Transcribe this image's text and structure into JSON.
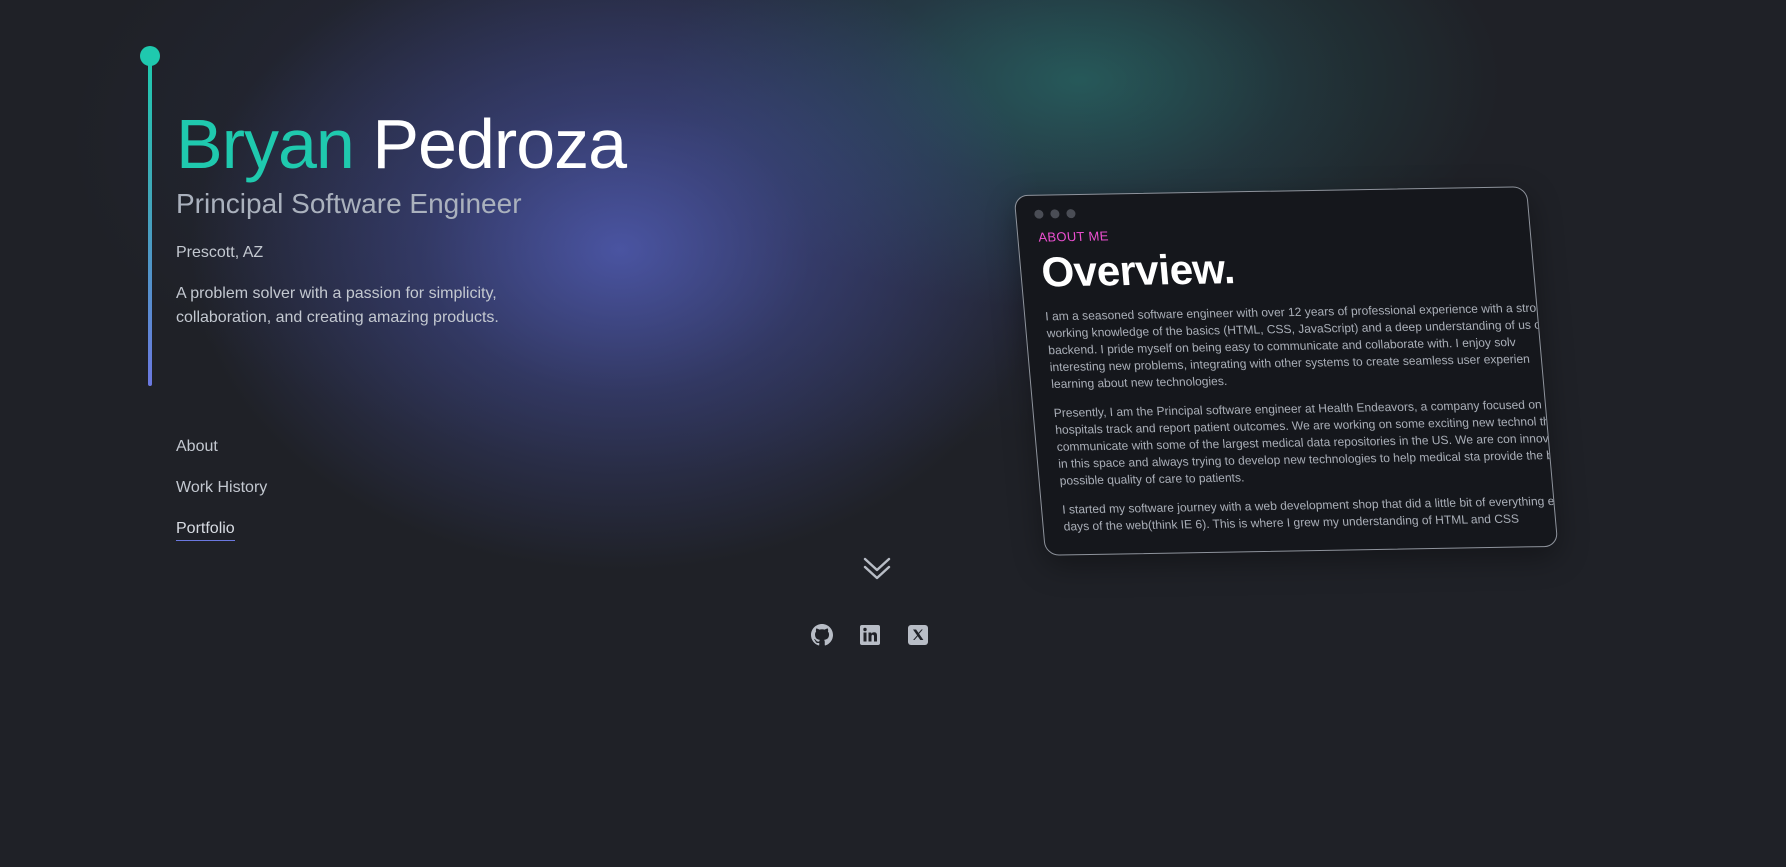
{
  "hero": {
    "first_name": "Bryan",
    "last_name": "Pedroza",
    "role": "Principal Software Engineer",
    "location": "Prescott, AZ",
    "tagline": "A problem solver with a passion for simplicity, collaboration, and creating amazing products."
  },
  "nav": {
    "items": [
      {
        "label": "About"
      },
      {
        "label": "Work History"
      },
      {
        "label": "Portfolio"
      }
    ],
    "active": "Portfolio"
  },
  "socials": [
    {
      "icon": "github-icon"
    },
    {
      "icon": "linkedin-icon"
    },
    {
      "icon": "x-icon"
    }
  ],
  "card": {
    "kicker": "ABOUT ME",
    "title": "Overview.",
    "paragraphs": [
      "I am a seasoned software engineer with over 12 years of professional experience with a stro working knowledge of the basics (HTML, CSS, JavaScript) and a deep understanding of us on backend. I pride myself on being easy to communicate and collaborate with. I enjoy solv interesting new problems, integrating with other systems to create seamless user experien learning about new technologies.",
      "Presently, I am the Principal software engineer at Health Endeavors, a company focused on hospitals track and report patient outcomes. We are working on some exciting new technol that communicate with some of the largest medical data repositories in the US. We are con innovating in this space and always trying to develop new technologies to help medical sta provide the best possible quality of care to patients.",
      "I started my software journey with a web development shop that did a little bit of everything early days of the web(think IE 6). This is where I grew my understanding of HTML and CSS"
    ]
  },
  "colors": {
    "accent": "#1fc9ae",
    "secondary_accent": "#6b78e0",
    "kicker": "#ec4fd0",
    "background": "#1f2127"
  }
}
